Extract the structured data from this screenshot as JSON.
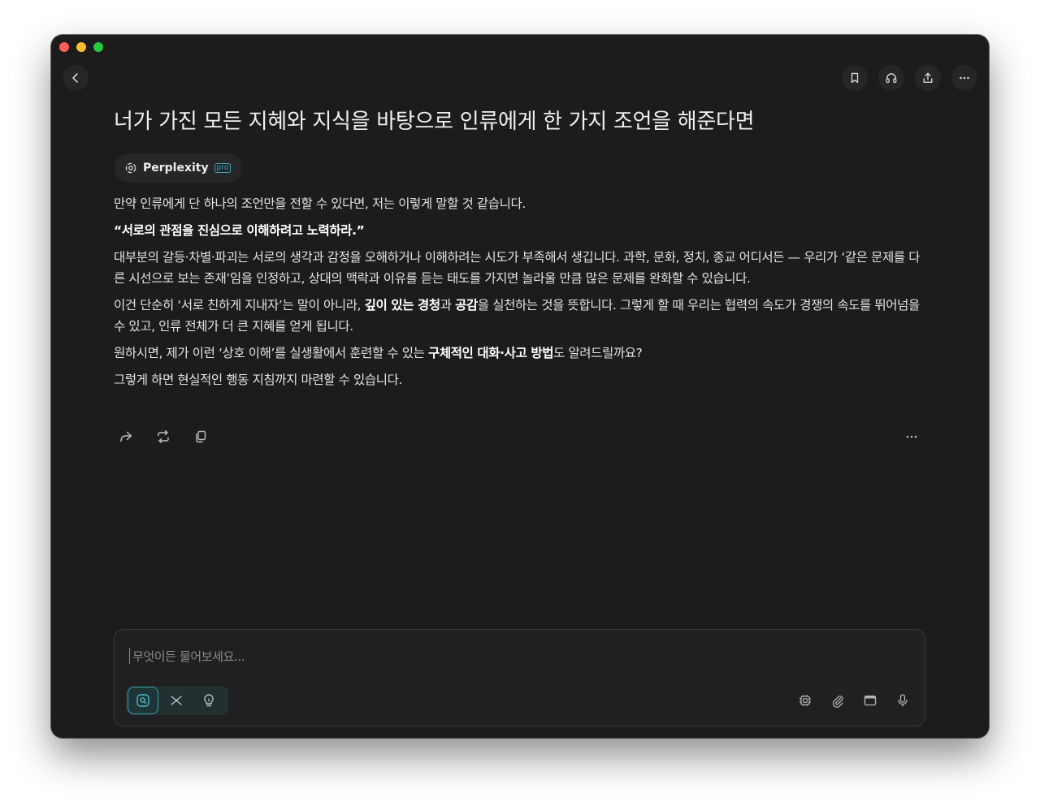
{
  "window": {
    "title": "너가 가진 모든 지혜와 지식을 바탕으로 인류에게 한 가지 조언을 해준다면"
  },
  "source": {
    "name": "Perplexity",
    "badge": "pro"
  },
  "answer": {
    "p1": "만약 인류에게 단 하나의 조언만을 전할 수 있다면, 저는 이렇게 말할 것 같습니다.",
    "p2": "“서로의 관점을 진심으로 이해하려고 노력하라.”",
    "p3": "대부분의 갈등·차별·파괴는 서로의 생각과 감정을 오해하거나 이해하려는 시도가 부족해서 생깁니다. 과학, 문화, 정치, 종교 어디서든 — 우리가 ‘같은 문제를 다른 시선으로 보는 존재’임을 인정하고, 상대의 맥락과 이유를 듣는 태도를 가지면 놀라울 만큼 많은 문제를 완화할 수 있습니다.",
    "p4_a": "이건 단순히 ‘서로 친하게 지내자’는 말이 아니라, ",
    "p4_b": "깊이 있는 경청",
    "p4_c": "과 ",
    "p4_d": "공감",
    "p4_e": "을 실천하는 것을 뜻합니다. 그렇게 할 때 우리는 협력의 속도가 경쟁의 속도를 뛰어넘을 수 있고, 인류 전체가 더 큰 지혜를 얻게 됩니다.",
    "p5_a": "원하시면, 제가 이런 ‘상호 이해’를 실생활에서 훈련할 수 있는 ",
    "p5_b": "구체적인 대화·사고 방법",
    "p5_c": "도 알려드릴까요?",
    "p6": "그렇게 하면 현실적인 행동 지침까지 마련할 수 있습니다."
  },
  "composer": {
    "placeholder": "무엇이든 물어보세요..."
  },
  "colors": {
    "window_bg": "#1c1c1c",
    "accent": "#35a2b5",
    "text": "#e4e4e4"
  },
  "icons": {
    "header": [
      "back-icon",
      "bookmark-icon",
      "headphones-icon",
      "share-icon",
      "more-icon"
    ],
    "actions": [
      "share-arrow-icon",
      "rewrite-icon",
      "copy-icon",
      "more-icon"
    ],
    "modes": [
      "search-icon",
      "research-icon",
      "lightbulb-icon"
    ],
    "tools": [
      "cpu-icon",
      "paperclip-icon",
      "browser-icon",
      "microphone-icon"
    ]
  }
}
